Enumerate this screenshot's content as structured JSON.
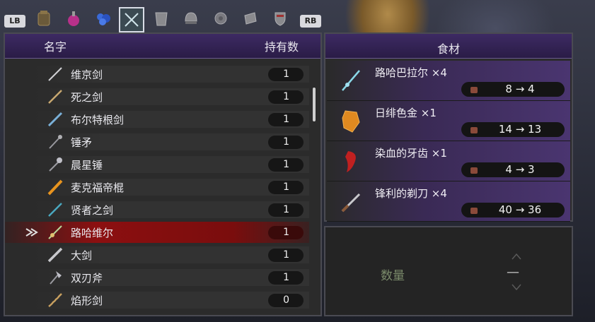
{
  "tabs": {
    "lb": "LB",
    "rb": "RB"
  },
  "inventory": {
    "col_name": "名字",
    "col_qty": "持有数",
    "items": [
      {
        "name": "维京剑",
        "qty": "1"
      },
      {
        "name": "死之剑",
        "qty": "1"
      },
      {
        "name": "布尔特根剑",
        "qty": "1"
      },
      {
        "name": "锤矛",
        "qty": "1"
      },
      {
        "name": "晨星锤",
        "qty": "1"
      },
      {
        "name": "麦克福帝棍",
        "qty": "1"
      },
      {
        "name": "贤者之剑",
        "qty": "1"
      },
      {
        "name": "路哈维尔",
        "qty": "1"
      },
      {
        "name": "大剑",
        "qty": "1"
      },
      {
        "name": "双刃斧",
        "qty": "1"
      },
      {
        "name": "焰形剑",
        "qty": "0"
      }
    ]
  },
  "ingredients": {
    "title": "食材",
    "items": [
      {
        "name": "路哈巴拉尔 ×4",
        "count": "8 → 4"
      },
      {
        "name": "日绯色金 ×1",
        "count": "14 → 13"
      },
      {
        "name": "染血的牙齿 ×1",
        "count": "4 → 3"
      },
      {
        "name": "锋利的剃刀 ×4",
        "count": "40 → 36"
      }
    ]
  },
  "quantity": {
    "label": "数量",
    "value": "—"
  }
}
